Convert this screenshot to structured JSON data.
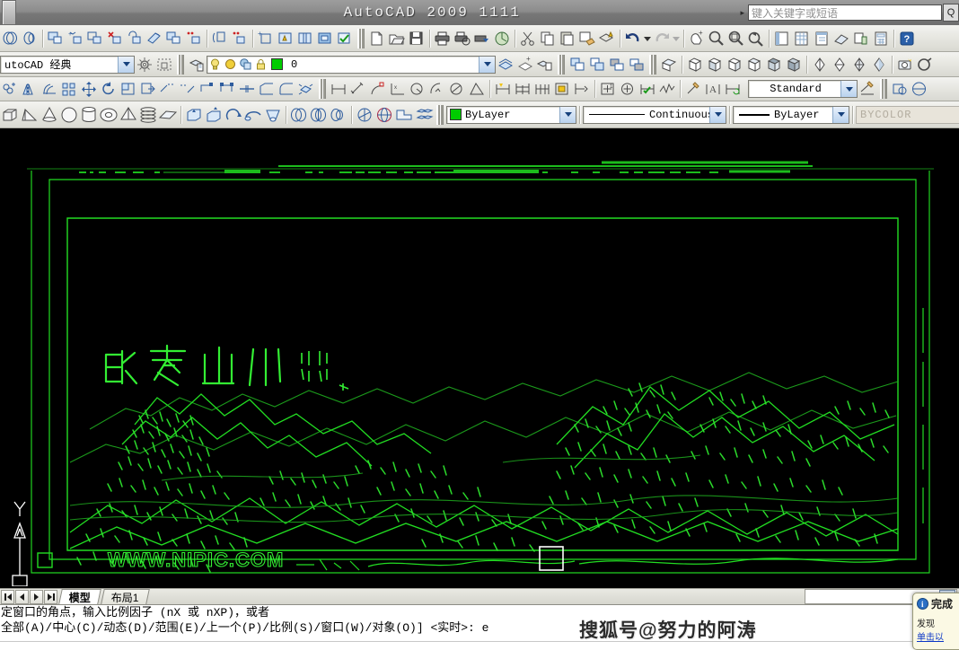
{
  "titlebar": {
    "app_title": "AutoCAD 2009  1111",
    "menu_arrow": "▸",
    "search_placeholder": "键入关键字或短语",
    "search_button_label": "Q",
    "search_icon": "search-icon"
  },
  "toolbars": {
    "workspace": {
      "value": "utoCAD 经典",
      "full_value": "AutoCAD 经典"
    },
    "layer": {
      "value": "0",
      "icons": [
        "layer-properties-icon",
        "lightbulb-on-icon",
        "sun-freeze-icon",
        "lock-plate-icon",
        "lock-icon"
      ],
      "color_swatch": "#00cc00"
    },
    "dimstyle": {
      "value": "Standard"
    },
    "properties": {
      "color": {
        "value": "ByLayer",
        "swatch": "#00cc00"
      },
      "linetype": {
        "value": "Continuous"
      },
      "lineweight": {
        "value": "ByLayer"
      },
      "plotstyle": {
        "value": "BYCOLOR",
        "disabled": true
      }
    },
    "row1_icons": [
      "workspace-toggle-icon",
      "workspace-toggle-2-icon",
      "solid-union-icon",
      "solid-add-icon",
      "solid-subtract-icon",
      "solid-delete-icon",
      "solid-rotate-icon",
      "solid-slice-icon",
      "solid-copy-icon",
      "solid-intersect-icon",
      "solid-extract-icon",
      "solid-imprint-icon",
      "solid-check-icon",
      "solid-clean-icon",
      "solid-separate-icon",
      "solid-shell-icon",
      "solid-validate-icon",
      "new-file-icon",
      "open-file-icon",
      "save-icon",
      "plot-icon",
      "plot-preview-icon",
      "publish-icon",
      "cut-icon",
      "copy-icon",
      "paste-icon",
      "match-properties-icon",
      "block-editor-icon",
      "undo-icon",
      "undo-dropdown-icon",
      "redo-icon",
      "redo-dropdown-icon",
      "pan-realtime-icon",
      "zoom-realtime-icon",
      "zoom-window-icon",
      "zoom-previous-icon",
      "properties-palette-icon",
      "designcenter-icon",
      "tool-palettes-icon",
      "sheet-set-icon",
      "markup-set-icon",
      "calculator-icon",
      "help-icon"
    ],
    "row2_icons": [
      "layers-icon",
      "layer-previous-icon",
      "layer-state-icon",
      "bring-to-front-icon",
      "send-to-back-icon",
      "bring-above-icon",
      "send-below-icon",
      "viewcube-icon",
      "view-sw-iso-icon",
      "view-se-iso-icon",
      "view-ne-iso-icon",
      "view-nw-iso-icon",
      "view-top-icon",
      "view-bottom-icon",
      "visualstyle-2dwire-icon",
      "visualstyle-3dwire-icon",
      "visualstyle-hidden-icon",
      "visualstyle-conceptual-icon",
      "render-icon",
      "named-views-icon"
    ],
    "row3_icons": [
      "copy-object-icon",
      "mirror-icon",
      "offset-icon",
      "array-icon",
      "move-icon",
      "rotate-icon",
      "scale-icon",
      "stretch-icon",
      "trim-icon",
      "extend-icon",
      "break-at-point-icon",
      "break-icon",
      "join-icon",
      "chamfer-icon",
      "fillet-icon",
      "explode-icon",
      "linear-dimension-icon",
      "aligned-dimension-icon",
      "arc-length-dimension-icon",
      "ordinate-dimension-icon",
      "radius-dimension-icon",
      "jogged-dimension-icon",
      "diameter-dimension-icon",
      "angular-dimension-icon",
      "quick-dimension-icon",
      "baseline-dimension-icon",
      "continue-dimension-icon",
      "quick-leader-icon",
      "tolerance-icon",
      "center-mark-icon",
      "inspect-dimension-icon",
      "jogged-linear-icon",
      "dim-edit-icon",
      "dim-text-edit-icon",
      "dim-update-icon",
      "dimstyle-manager-icon",
      "multiline-text-icon"
    ],
    "row4_icons": [
      "box-icon",
      "wedge-icon",
      "cone-icon",
      "sphere-icon",
      "cylinder-icon",
      "torus-icon",
      "pyramid-icon",
      "helix-icon",
      "planar-surface-icon",
      "extrude-icon",
      "presspull-icon",
      "revolve-icon",
      "sweep-icon",
      "loft-icon",
      "union-icon",
      "subtract-icon",
      "intersect-icon",
      "3d-move-icon",
      "3d-rotate-icon",
      "3d-align-icon",
      "3d-array-icon"
    ]
  },
  "drawing": {
    "title_text": "欧秀山川",
    "seal_text": "印",
    "bottom_outline_text": "WWW.NIPIC.COM",
    "line_color": "#22dd22",
    "background": "#000000",
    "ucs_axis_label": "Y",
    "selection_box": true
  },
  "bottom": {
    "nav_first": "first-tab-icon",
    "nav_prev": "prev-tab-icon",
    "nav_next": "next-tab-icon",
    "nav_last": "last-tab-icon",
    "tabs": [
      {
        "label": "模型",
        "active": true
      },
      {
        "label": "布局1",
        "active": false
      }
    ],
    "scroll_left_label": "◀"
  },
  "command_line": {
    "line1": "定窗口的角点，输入比例因子 (nX 或 nXP)，或者",
    "line2": "全部(A)/中心(C)/动态(D)/范围(E)/上一个(P)/比例(S)/窗口(W)/对象(O)] <实时>: e"
  },
  "watermark": {
    "text": "搜狐号@努力的阿涛"
  },
  "balloon": {
    "icon": "info-icon",
    "title": "完成",
    "body": "发现",
    "link": "单击以"
  }
}
